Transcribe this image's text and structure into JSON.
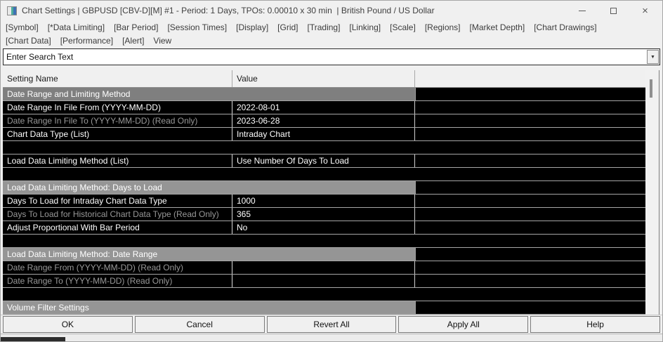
{
  "window": {
    "title": "Chart Settings | GBPUSD [CBV-D][M] #1 - Period: 1 Days, TPOs: 0.00010 x 30 min  | British Pound / US Dollar",
    "controls": {
      "close_glyph": "×"
    }
  },
  "menu": {
    "row1": [
      "[Symbol]",
      "[*Data Limiting]",
      "[Bar Period]",
      "[Session Times]",
      "[Display]",
      "[Grid]",
      "[Trading]",
      "[Linking]",
      "[Scale]",
      "[Regions]",
      "[Market Depth]",
      "[Chart Drawings]"
    ],
    "row2": [
      "[Chart Data]",
      "[Performance]",
      "[Alert]",
      "View"
    ]
  },
  "search": {
    "value": "Enter Search Text",
    "arrow_glyph": "▼"
  },
  "table": {
    "columns": [
      "Setting Name",
      "Value"
    ],
    "rows": [
      {
        "type": "section",
        "label": "Date Range and Limiting Method",
        "variant": "dark"
      },
      {
        "type": "setting",
        "name": "Date Range In File From (YYYY-MM-DD)",
        "value": "2022-08-01",
        "readonly": false
      },
      {
        "type": "setting",
        "name": "Date Range In File To (YYYY-MM-DD) (Read Only)",
        "value": "2023-06-28",
        "readonly": true
      },
      {
        "type": "setting",
        "name": "Chart Data Type (List)",
        "value": "Intraday Chart",
        "readonly": false
      },
      {
        "type": "spacer"
      },
      {
        "type": "setting",
        "name": "Load Data Limiting Method (List)",
        "value": "Use Number Of Days To Load",
        "readonly": false
      },
      {
        "type": "spacer"
      },
      {
        "type": "section",
        "label": "Load Data Limiting Method: Days to Load"
      },
      {
        "type": "setting",
        "name": "Days To Load for Intraday Chart Data Type",
        "value": "1000",
        "readonly": false
      },
      {
        "type": "setting",
        "name": "Days To Load for Historical Chart Data Type (Read Only)",
        "value": "365",
        "readonly": true
      },
      {
        "type": "setting",
        "name": "Adjust Proportional With Bar Period",
        "value": "No",
        "readonly": false
      },
      {
        "type": "spacer"
      },
      {
        "type": "section",
        "label": "Load Data Limiting Method: Date Range"
      },
      {
        "type": "setting",
        "name": "Date Range From (YYYY-MM-DD) (Read Only)",
        "value": "",
        "readonly": true
      },
      {
        "type": "setting",
        "name": "Date Range To (YYYY-MM-DD) (Read Only)",
        "value": "",
        "readonly": true
      },
      {
        "type": "spacer"
      },
      {
        "type": "section",
        "label": "Volume Filter Settings"
      }
    ]
  },
  "buttons": [
    "OK",
    "Cancel",
    "Revert All",
    "Apply All",
    "Help"
  ],
  "colors": {
    "row_bg": "#000000",
    "section_bg": "#959595",
    "section_bg_first": "#7f7f7f",
    "readonly_text": "#989898",
    "chrome_bg": "#f0f0f0",
    "taskbar_dark": "#2c2c2c"
  }
}
